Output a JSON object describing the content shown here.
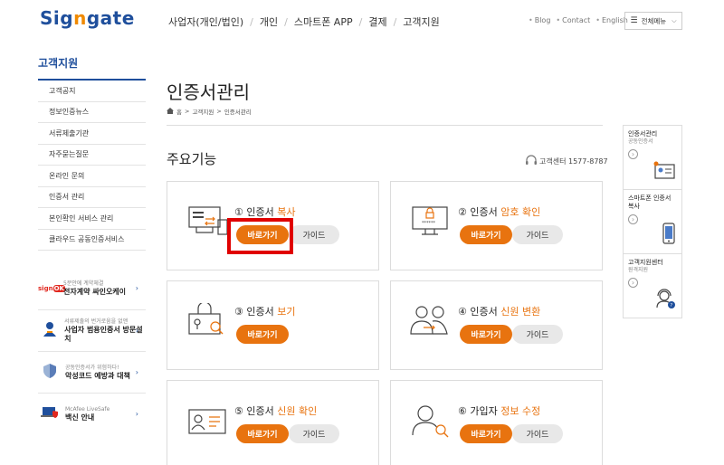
{
  "header": {
    "logo_text_1": "Sig",
    "logo_text_2": "n",
    "logo_text_3": "gate",
    "nav": [
      "사업자(개인/법인)",
      "개인",
      "스마트폰 APP",
      "결제",
      "고객지원"
    ],
    "util": [
      "Blog",
      "Contact",
      "English"
    ],
    "all_menu": "전체메뉴"
  },
  "sidebar": {
    "title": "고객지원",
    "items": [
      "고객공지",
      "정보인증뉴스",
      "서류제출기관",
      "자주묻는질문",
      "온라인 문의",
      "인증서 관리",
      "본인확인 서비스 관리",
      "클라우드 공동인증서비스"
    ],
    "banners": [
      {
        "icon": "signOK",
        "small": "5분안에 계약체결",
        "big": "전자계약 싸인오케이"
      },
      {
        "icon": "person",
        "small": "서류제출의 번거로움을 없앤",
        "big": "사업자 범용인증서 방문설치"
      },
      {
        "icon": "shield",
        "small": "공동인증서가 위험하다!",
        "big": "악성코드 예방과 대책"
      },
      {
        "icon": "mcafee",
        "small": "McAfee LiveSafe",
        "big": "백신 안내"
      }
    ]
  },
  "main": {
    "page_title": "인증서관리",
    "breadcrumb": [
      "홈",
      "고객지원",
      "인증서관리"
    ],
    "section_title": "주요기능",
    "cs_center": "고객센터 1577-8787",
    "cards": [
      {
        "num": "①",
        "title": "인증서 ",
        "highlight": "복사",
        "go": "바로가기",
        "guide": "가이드"
      },
      {
        "num": "②",
        "title": "인증서 ",
        "highlight": "암호 확인",
        "go": "바로가기",
        "guide": "가이드"
      },
      {
        "num": "③",
        "title": "인증서 ",
        "highlight": "보기",
        "go": "바로가기"
      },
      {
        "num": "④",
        "title": "인증서 ",
        "highlight": "신원 변환",
        "go": "바로가기",
        "guide": "가이드"
      },
      {
        "num": "⑤",
        "title": "인증서 ",
        "highlight": "신원 확인",
        "go": "바로가기",
        "guide": "가이드"
      },
      {
        "num": "⑥",
        "title": "가입자 ",
        "highlight": "정보 수정",
        "go": "바로가기",
        "guide": "가이드"
      }
    ]
  },
  "quick": [
    {
      "title": "인증서관리",
      "sub": "공동인증서"
    },
    {
      "title": "스마트폰 인증서 복사",
      "sub": ""
    },
    {
      "title": "고객지원센터",
      "sub": "원격지원"
    }
  ],
  "colors": {
    "brand": "#1f4f9c",
    "accent": "#e8730f",
    "highlight": "#e00000"
  }
}
